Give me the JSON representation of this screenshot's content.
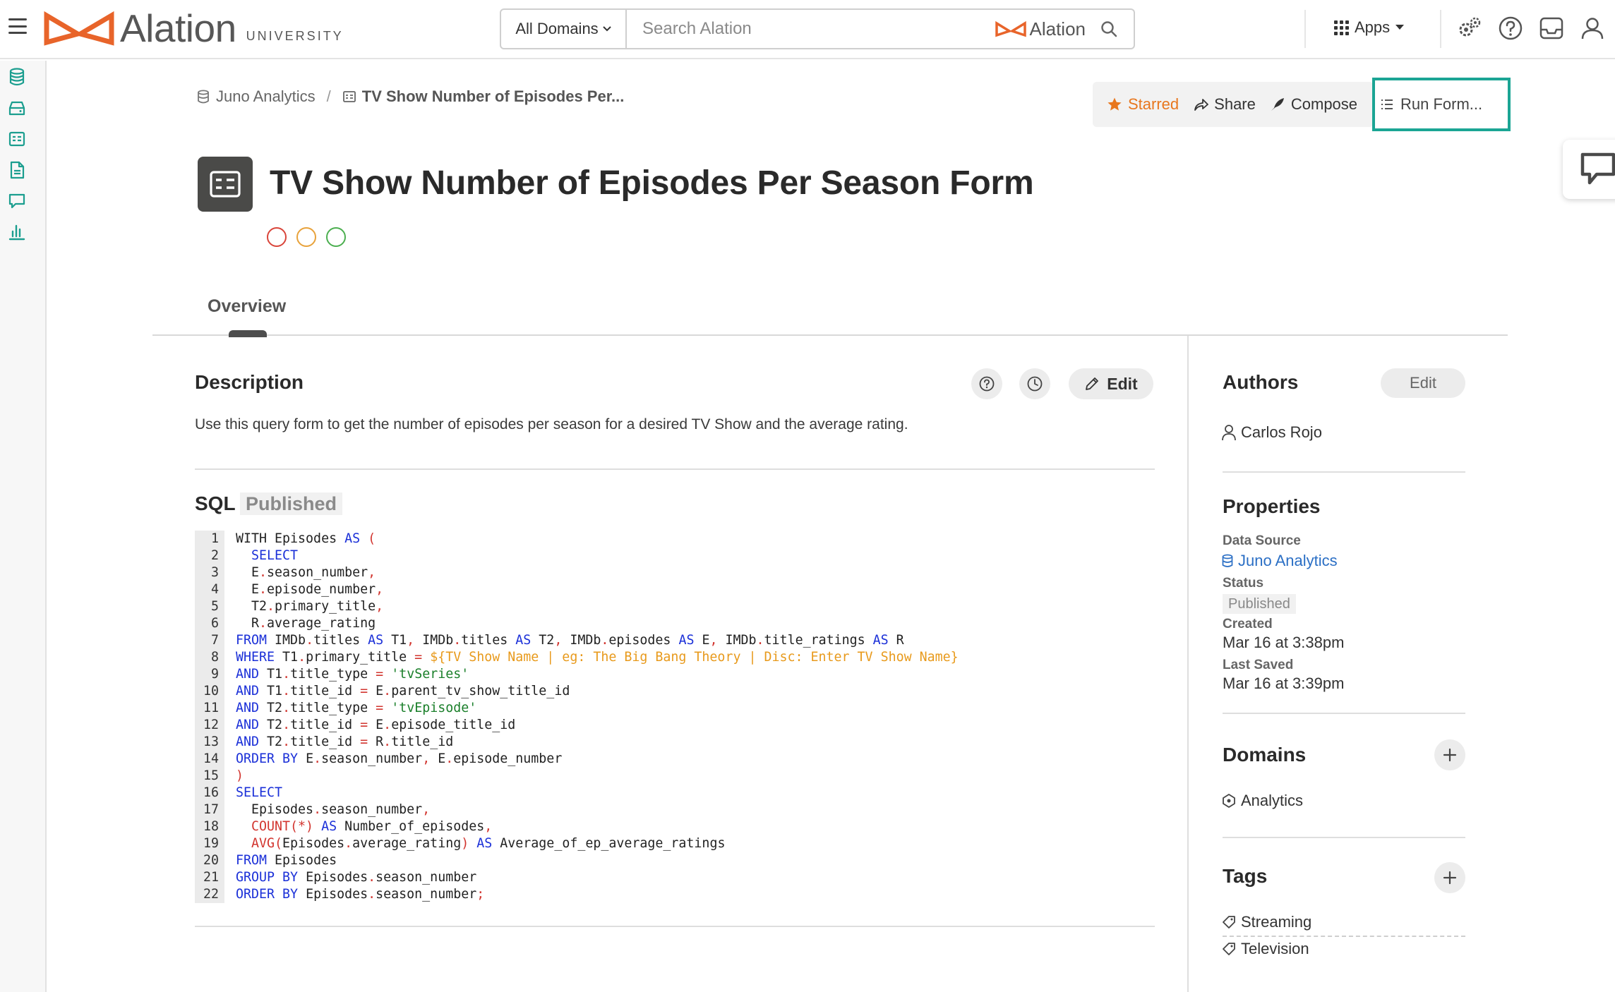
{
  "brand": {
    "name": "Alation",
    "suffix": "UNIVERSITY",
    "accent": "#e8642a"
  },
  "search": {
    "domain_label": "All Domains",
    "placeholder": "Search Alation",
    "brand_label": "Alation"
  },
  "topnav": {
    "apps_label": "Apps"
  },
  "breadcrumb": {
    "parent": "Juno Analytics",
    "separator": "/",
    "current": "TV Show Number of Episodes Per..."
  },
  "actions": {
    "starred": "Starred",
    "share": "Share",
    "compose": "Compose",
    "run_form": "Run Form..."
  },
  "page": {
    "title": "TV Show Number of Episodes Per Season Form",
    "trust_flag_colors": [
      "#d9453a",
      "#e8a23b",
      "#4caf50"
    ]
  },
  "tabs": [
    {
      "label": "Overview",
      "active": true
    }
  ],
  "description": {
    "title": "Description",
    "edit_label": "Edit",
    "text": "Use this query form to get the number of episodes per season for a desired TV Show and the average rating."
  },
  "sql": {
    "title": "SQL",
    "status": "Published",
    "lines": [
      [
        [
          "t",
          "WITH Episodes "
        ],
        [
          "kw",
          "AS"
        ],
        [
          "t",
          " "
        ],
        [
          "op",
          "("
        ]
      ],
      [
        [
          "t",
          "  "
        ],
        [
          "kw",
          "SELECT"
        ]
      ],
      [
        [
          "t",
          "  E"
        ],
        [
          "op",
          "."
        ],
        [
          "t",
          "season_number"
        ],
        [
          "op",
          ","
        ]
      ],
      [
        [
          "t",
          "  E"
        ],
        [
          "op",
          "."
        ],
        [
          "t",
          "episode_number"
        ],
        [
          "op",
          ","
        ]
      ],
      [
        [
          "t",
          "  T2"
        ],
        [
          "op",
          "."
        ],
        [
          "t",
          "primary_title"
        ],
        [
          "op",
          ","
        ]
      ],
      [
        [
          "t",
          "  R"
        ],
        [
          "op",
          "."
        ],
        [
          "t",
          "average_rating"
        ]
      ],
      [
        [
          "kw",
          "FROM"
        ],
        [
          "t",
          " IMDb"
        ],
        [
          "op",
          "."
        ],
        [
          "t",
          "titles "
        ],
        [
          "kw",
          "AS"
        ],
        [
          "t",
          " T1"
        ],
        [
          "op",
          ","
        ],
        [
          "t",
          " IMDb"
        ],
        [
          "op",
          "."
        ],
        [
          "t",
          "titles "
        ],
        [
          "kw",
          "AS"
        ],
        [
          "t",
          " T2"
        ],
        [
          "op",
          ","
        ],
        [
          "t",
          " IMDb"
        ],
        [
          "op",
          "."
        ],
        [
          "t",
          "episodes "
        ],
        [
          "kw",
          "AS"
        ],
        [
          "t",
          " E"
        ],
        [
          "op",
          ","
        ],
        [
          "t",
          " IMDb"
        ],
        [
          "op",
          "."
        ],
        [
          "t",
          "title_ratings "
        ],
        [
          "kw",
          "AS"
        ],
        [
          "t",
          " R"
        ]
      ],
      [
        [
          "kw",
          "WHERE"
        ],
        [
          "t",
          " T1"
        ],
        [
          "op",
          "."
        ],
        [
          "t",
          "primary_title "
        ],
        [
          "op",
          "="
        ],
        [
          "t",
          " "
        ],
        [
          "var",
          "${TV Show Name | eg: The Big Bang Theory | Disc: Enter TV Show Name}"
        ]
      ],
      [
        [
          "kw",
          "AND"
        ],
        [
          "t",
          " T1"
        ],
        [
          "op",
          "."
        ],
        [
          "t",
          "title_type "
        ],
        [
          "op",
          "="
        ],
        [
          "t",
          " "
        ],
        [
          "str",
          "'tvSeries'"
        ]
      ],
      [
        [
          "kw",
          "AND"
        ],
        [
          "t",
          " T1"
        ],
        [
          "op",
          "."
        ],
        [
          "t",
          "title_id "
        ],
        [
          "op",
          "="
        ],
        [
          "t",
          " E"
        ],
        [
          "op",
          "."
        ],
        [
          "t",
          "parent_tv_show_title_id"
        ]
      ],
      [
        [
          "kw",
          "AND"
        ],
        [
          "t",
          " T2"
        ],
        [
          "op",
          "."
        ],
        [
          "t",
          "title_type "
        ],
        [
          "op",
          "="
        ],
        [
          "t",
          " "
        ],
        [
          "str",
          "'tvEpisode'"
        ]
      ],
      [
        [
          "kw",
          "AND"
        ],
        [
          "t",
          " T2"
        ],
        [
          "op",
          "."
        ],
        [
          "t",
          "title_id "
        ],
        [
          "op",
          "="
        ],
        [
          "t",
          " E"
        ],
        [
          "op",
          "."
        ],
        [
          "t",
          "episode_title_id"
        ]
      ],
      [
        [
          "kw",
          "AND"
        ],
        [
          "t",
          " T2"
        ],
        [
          "op",
          "."
        ],
        [
          "t",
          "title_id "
        ],
        [
          "op",
          "="
        ],
        [
          "t",
          " R"
        ],
        [
          "op",
          "."
        ],
        [
          "t",
          "title_id"
        ]
      ],
      [
        [
          "kw",
          "ORDER BY"
        ],
        [
          "t",
          " E"
        ],
        [
          "op",
          "."
        ],
        [
          "t",
          "season_number"
        ],
        [
          "op",
          ","
        ],
        [
          "t",
          " E"
        ],
        [
          "op",
          "."
        ],
        [
          "t",
          "episode_number"
        ]
      ],
      [
        [
          "op",
          ")"
        ]
      ],
      [
        [
          "kw",
          "SELECT"
        ]
      ],
      [
        [
          "t",
          "  Episodes"
        ],
        [
          "op",
          "."
        ],
        [
          "t",
          "season_number"
        ],
        [
          "op",
          ","
        ]
      ],
      [
        [
          "t",
          "  "
        ],
        [
          "op",
          "COUNT(*)"
        ],
        [
          "t",
          " "
        ],
        [
          "kw",
          "AS"
        ],
        [
          "t",
          " Number_of_episodes"
        ],
        [
          "op",
          ","
        ]
      ],
      [
        [
          "t",
          "  "
        ],
        [
          "op",
          "AVG("
        ],
        [
          "t",
          "Episodes"
        ],
        [
          "op",
          "."
        ],
        [
          "t",
          "average_rating"
        ],
        [
          "op",
          ")"
        ],
        [
          "t",
          " "
        ],
        [
          "kw",
          "AS"
        ],
        [
          "t",
          " Average_of_ep_average_ratings"
        ]
      ],
      [
        [
          "kw",
          "FROM"
        ],
        [
          "t",
          " Episodes"
        ]
      ],
      [
        [
          "kw",
          "GROUP BY"
        ],
        [
          "t",
          " Episodes"
        ],
        [
          "op",
          "."
        ],
        [
          "t",
          "season_number"
        ]
      ],
      [
        [
          "kw",
          "ORDER BY"
        ],
        [
          "t",
          " Episodes"
        ],
        [
          "op",
          "."
        ],
        [
          "t",
          "season_number"
        ],
        [
          "op",
          ";"
        ]
      ]
    ]
  },
  "authors": {
    "title": "Authors",
    "edit_label": "Edit",
    "items": [
      "Carlos Rojo"
    ]
  },
  "properties": {
    "title": "Properties",
    "data_source_label": "Data Source",
    "data_source_value": "Juno Analytics",
    "status_label": "Status",
    "status_value": "Published",
    "created_label": "Created",
    "created_value": "Mar 16 at 3:38pm",
    "last_saved_label": "Last Saved",
    "last_saved_value": "Mar 16 at 3:39pm"
  },
  "domains": {
    "title": "Domains",
    "items": [
      "Analytics"
    ]
  },
  "tags": {
    "title": "Tags",
    "items": [
      "Streaming",
      "Television"
    ]
  },
  "icons": [
    "menu-icon",
    "database-icon",
    "folder-icon",
    "form-icon",
    "document-icon",
    "conversation-icon",
    "chart-icon",
    "search-icon",
    "apps-grid-icon",
    "settings-icon",
    "help-icon",
    "inbox-icon",
    "user-icon",
    "star-icon",
    "share-icon",
    "compose-icon",
    "list-icon",
    "chat-icon",
    "pencil-icon",
    "history-icon",
    "plus-icon",
    "tag-icon",
    "domain-icon"
  ]
}
